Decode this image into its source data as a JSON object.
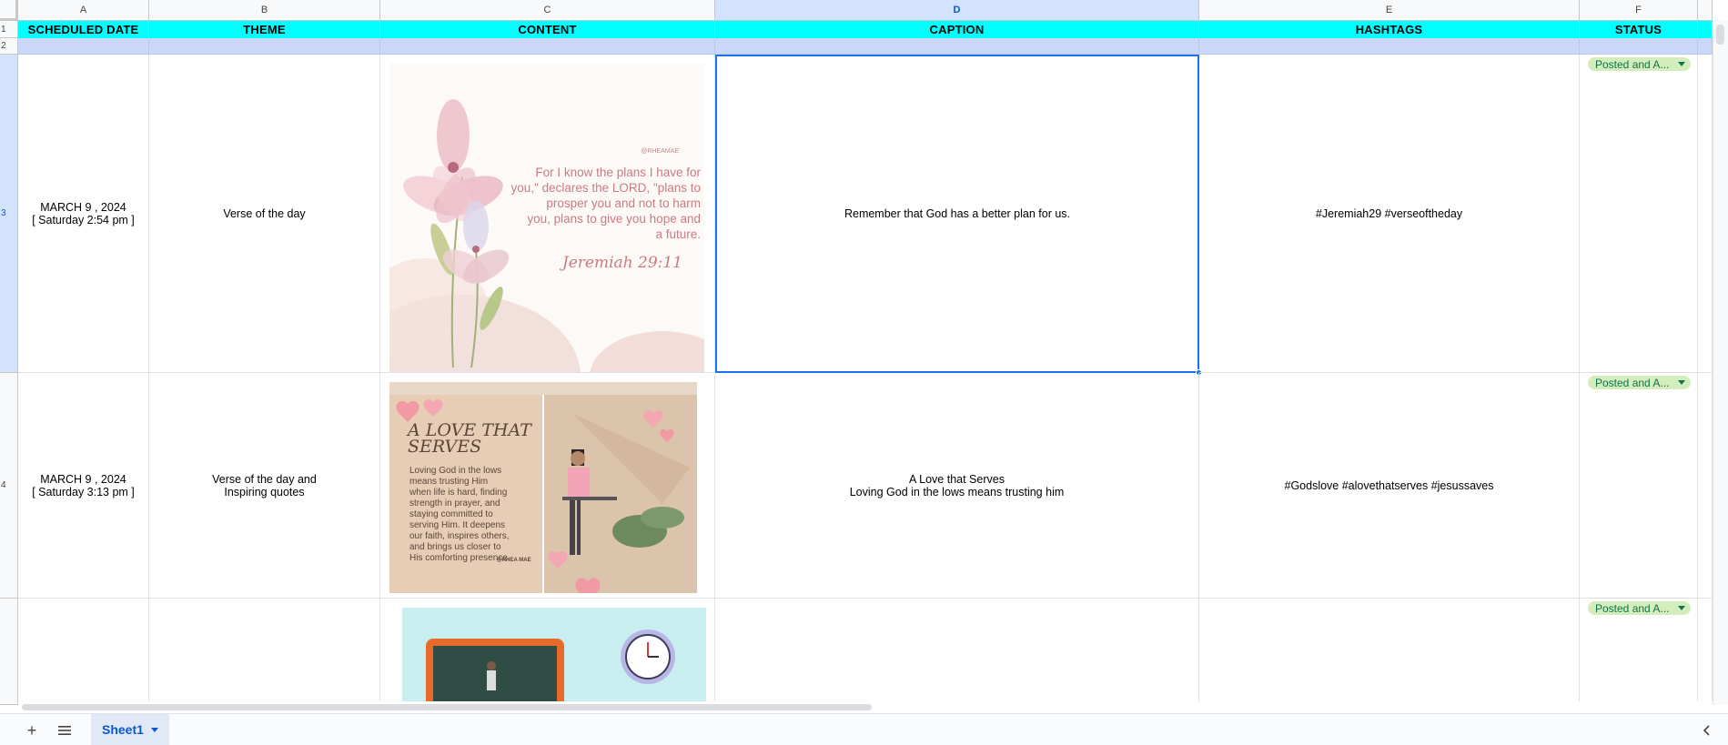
{
  "sheet": {
    "column_letters": [
      "A",
      "B",
      "C",
      "D",
      "E",
      "F"
    ],
    "row_numbers": [
      "1",
      "2",
      "3",
      "4"
    ],
    "headers": [
      "SCHEDULED DATE",
      "THEME",
      "CONTENT",
      "CAPTION",
      "HASHTAGS",
      "STATUS"
    ],
    "rows": [
      {
        "date": "MARCH 9 , 2024\n[ Saturday 2:54 pm ]",
        "theme": "Verse of the day",
        "content_image": "floral verse card image",
        "caption": "Remember that God has a better plan for us.",
        "hashtags": "#Jeremiah29 #verseoftheday",
        "status": "Posted and A..."
      },
      {
        "date": "MARCH 9 , 2024\n[ Saturday 3:13 pm ]",
        "theme": "Verse of the day and\nInspiring quotes",
        "content_image": "a love that serves collage image",
        "caption": "A Love that Serves\nLoving God in the lows means trusting him",
        "hashtags": "#Godslove #alovethatserves #jesussaves",
        "status": "Posted and A..."
      },
      {
        "date": "",
        "theme": "",
        "content_image": "classroom and clock collage image",
        "caption": "",
        "hashtags": "",
        "status": "Posted and A..."
      }
    ]
  },
  "images": {
    "verse_card": {
      "handle": "@RHEAMAE",
      "verse_lines": [
        "For I know the plans I have for",
        "you,\" declares the LORD, \"plans to",
        "prosper you and not to harm",
        "you, plans to give you hope and",
        "a future."
      ],
      "reference": "Jeremiah 29:11"
    },
    "love_card": {
      "title_lines": [
        "A LOVE THAT",
        "SERVES"
      ],
      "body_lines": [
        "Loving God in the lows",
        "means trusting Him",
        "when life is hard, finding",
        "strength in prayer, and",
        "staying committed to",
        "serving Him. It deepens",
        "our faith, inspires others,",
        "and brings us closer to",
        "His comforting presence."
      ],
      "handle": "@RHEA MAE"
    }
  },
  "bottom_bar": {
    "add_sheet_icon": "plus-icon",
    "all_sheets_icon": "menu-icon",
    "sheet_tab_label": "Sheet1",
    "explore_icon": "chevron-left-icon"
  },
  "colors": {
    "header_fill": "#00ffff",
    "band_fill": "#c9d7f8",
    "status_chip": "#d4edbc",
    "status_text": "#11734b",
    "selection": "#1a73e8"
  }
}
